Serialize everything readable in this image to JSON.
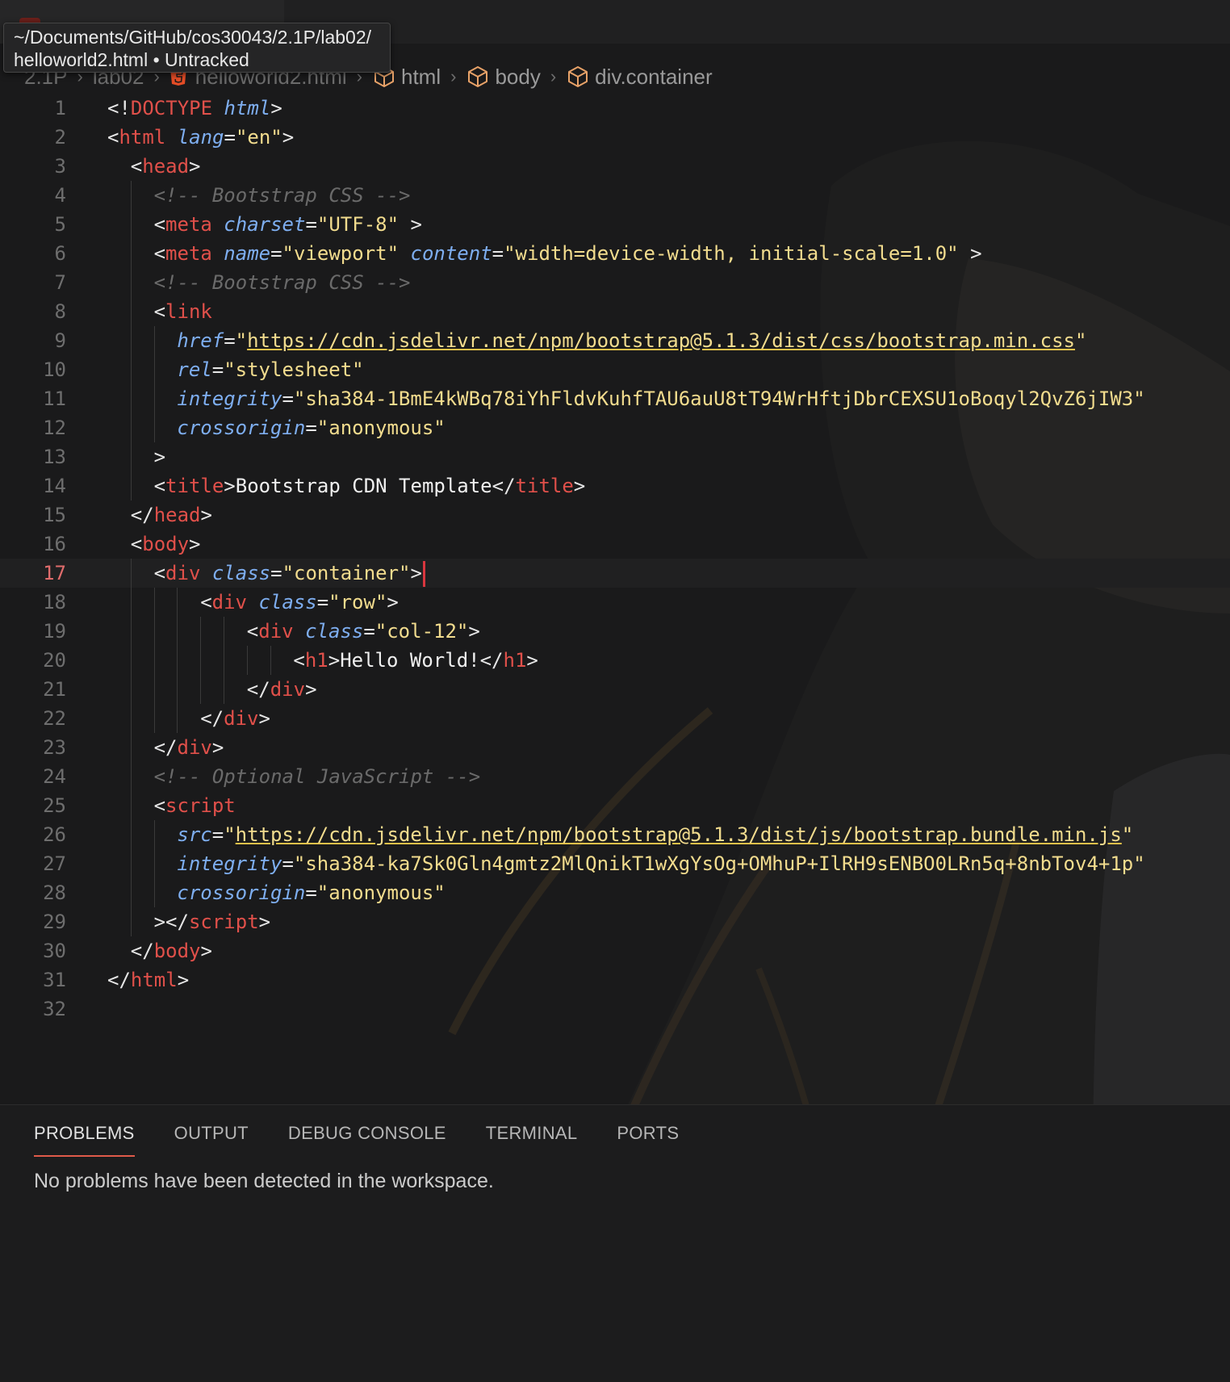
{
  "tooltip": {
    "line1": "~/Documents/GitHub/cos30043/2.1P/lab02/",
    "line2": "helloworld2.html • Untracked"
  },
  "breadcrumb": {
    "folder1": "2.1P",
    "folder2": "lab02",
    "file": "helloworld2.html",
    "sym1": "html",
    "sym2": "body",
    "sym3": "div.container"
  },
  "editor": {
    "current_line": 17,
    "lines": [
      {
        "n": "1",
        "indent": 0,
        "tokens": [
          [
            "p",
            "<!"
          ],
          [
            "t",
            "DOCTYPE"
          ],
          [
            "p",
            " "
          ],
          [
            "a",
            "html"
          ],
          [
            "p",
            ">"
          ]
        ]
      },
      {
        "n": "2",
        "indent": 0,
        "tokens": [
          [
            "p",
            "<"
          ],
          [
            "t",
            "html"
          ],
          [
            "p",
            " "
          ],
          [
            "a",
            "lang"
          ],
          [
            "p",
            "="
          ],
          [
            "v",
            "\"en\""
          ],
          [
            "p",
            ">"
          ]
        ]
      },
      {
        "n": "3",
        "indent": 1,
        "tokens": [
          [
            "p",
            "<"
          ],
          [
            "t",
            "head"
          ],
          [
            "p",
            ">"
          ]
        ]
      },
      {
        "n": "4",
        "indent": 2,
        "tokens": [
          [
            "c",
            "<!-- Bootstrap CSS -->"
          ]
        ]
      },
      {
        "n": "5",
        "indent": 2,
        "tokens": [
          [
            "p",
            "<"
          ],
          [
            "t",
            "meta"
          ],
          [
            "p",
            " "
          ],
          [
            "a",
            "charset"
          ],
          [
            "p",
            "="
          ],
          [
            "v",
            "\"UTF-8\""
          ],
          [
            "p",
            " >"
          ]
        ]
      },
      {
        "n": "6",
        "indent": 2,
        "tokens": [
          [
            "p",
            "<"
          ],
          [
            "t",
            "meta"
          ],
          [
            "p",
            " "
          ],
          [
            "a",
            "name"
          ],
          [
            "p",
            "="
          ],
          [
            "v",
            "\"viewport\""
          ],
          [
            "p",
            " "
          ],
          [
            "a",
            "content"
          ],
          [
            "p",
            "="
          ],
          [
            "v",
            "\"width=device-width, initial-scale=1.0\""
          ],
          [
            "p",
            " >"
          ]
        ]
      },
      {
        "n": "7",
        "indent": 2,
        "tokens": [
          [
            "c",
            "<!-- Bootstrap CSS -->"
          ]
        ]
      },
      {
        "n": "8",
        "indent": 2,
        "tokens": [
          [
            "p",
            "<"
          ],
          [
            "t",
            "link"
          ]
        ]
      },
      {
        "n": "9",
        "indent": 3,
        "tokens": [
          [
            "a",
            "href"
          ],
          [
            "p",
            "="
          ],
          [
            "v",
            "\""
          ],
          [
            "u",
            "https://cdn.jsdelivr.net/npm/bootstrap@5.1.3/dist/css/bootstrap.min.css"
          ],
          [
            "v",
            "\""
          ]
        ]
      },
      {
        "n": "10",
        "indent": 3,
        "tokens": [
          [
            "a",
            "rel"
          ],
          [
            "p",
            "="
          ],
          [
            "v",
            "\"stylesheet\""
          ]
        ]
      },
      {
        "n": "11",
        "indent": 3,
        "tokens": [
          [
            "a",
            "integrity"
          ],
          [
            "p",
            "="
          ],
          [
            "v",
            "\"sha384-1BmE4kWBq78iYhFldvKuhfTAU6auU8tT94WrHftjDbrCEXSU1oBoqyl2QvZ6jIW3\""
          ]
        ]
      },
      {
        "n": "12",
        "indent": 3,
        "tokens": [
          [
            "a",
            "crossorigin"
          ],
          [
            "p",
            "="
          ],
          [
            "v",
            "\"anonymous\""
          ]
        ]
      },
      {
        "n": "13",
        "indent": 2,
        "tokens": [
          [
            "p",
            ">"
          ]
        ]
      },
      {
        "n": "14",
        "indent": 2,
        "tokens": [
          [
            "p",
            "<"
          ],
          [
            "t",
            "title"
          ],
          [
            "p",
            ">"
          ],
          [
            "x",
            "Bootstrap CDN Template"
          ],
          [
            "p",
            "</"
          ],
          [
            "t",
            "title"
          ],
          [
            "p",
            ">"
          ]
        ]
      },
      {
        "n": "15",
        "indent": 1,
        "tokens": [
          [
            "p",
            "</"
          ],
          [
            "t",
            "head"
          ],
          [
            "p",
            ">"
          ]
        ]
      },
      {
        "n": "16",
        "indent": 1,
        "tokens": [
          [
            "p",
            "<"
          ],
          [
            "t",
            "body"
          ],
          [
            "p",
            ">"
          ]
        ]
      },
      {
        "n": "17",
        "indent": 2,
        "tokens": [
          [
            "p",
            "<"
          ],
          [
            "t",
            "div"
          ],
          [
            "p",
            " "
          ],
          [
            "a",
            "class"
          ],
          [
            "p",
            "="
          ],
          [
            "v",
            "\"container\""
          ],
          [
            "p",
            ">"
          ]
        ]
      },
      {
        "n": "18",
        "indent": 4,
        "tokens": [
          [
            "p",
            "<"
          ],
          [
            "t",
            "div"
          ],
          [
            "p",
            " "
          ],
          [
            "a",
            "class"
          ],
          [
            "p",
            "="
          ],
          [
            "v",
            "\"row\""
          ],
          [
            "p",
            ">"
          ]
        ]
      },
      {
        "n": "19",
        "indent": 6,
        "tokens": [
          [
            "p",
            "<"
          ],
          [
            "t",
            "div"
          ],
          [
            "p",
            " "
          ],
          [
            "a",
            "class"
          ],
          [
            "p",
            "="
          ],
          [
            "v",
            "\"col-12\""
          ],
          [
            "p",
            ">"
          ]
        ]
      },
      {
        "n": "20",
        "indent": 8,
        "tokens": [
          [
            "p",
            "<"
          ],
          [
            "t",
            "h1"
          ],
          [
            "p",
            ">"
          ],
          [
            "x",
            "Hello World!"
          ],
          [
            "p",
            "</"
          ],
          [
            "t",
            "h1"
          ],
          [
            "p",
            ">"
          ]
        ]
      },
      {
        "n": "21",
        "indent": 6,
        "tokens": [
          [
            "p",
            "</"
          ],
          [
            "t",
            "div"
          ],
          [
            "p",
            ">"
          ]
        ]
      },
      {
        "n": "22",
        "indent": 4,
        "tokens": [
          [
            "p",
            "</"
          ],
          [
            "t",
            "div"
          ],
          [
            "p",
            ">"
          ]
        ]
      },
      {
        "n": "23",
        "indent": 2,
        "tokens": [
          [
            "p",
            "</"
          ],
          [
            "t",
            "div"
          ],
          [
            "p",
            ">"
          ]
        ]
      },
      {
        "n": "24",
        "indent": 2,
        "tokens": [
          [
            "c",
            "<!-- Optional JavaScript -->"
          ]
        ]
      },
      {
        "n": "25",
        "indent": 2,
        "tokens": [
          [
            "p",
            "<"
          ],
          [
            "t",
            "script"
          ]
        ]
      },
      {
        "n": "26",
        "indent": 3,
        "tokens": [
          [
            "a",
            "src"
          ],
          [
            "p",
            "="
          ],
          [
            "v",
            "\""
          ],
          [
            "u",
            "https://cdn.jsdelivr.net/npm/bootstrap@5.1.3/dist/js/bootstrap.bundle.min.js"
          ],
          [
            "v",
            "\""
          ]
        ]
      },
      {
        "n": "27",
        "indent": 3,
        "tokens": [
          [
            "a",
            "integrity"
          ],
          [
            "p",
            "="
          ],
          [
            "v",
            "\"sha384-ka7Sk0Gln4gmtz2MlQnikT1wXgYsOg+OMhuP+IlRH9sENBO0LRn5q+8nbTov4+1p\""
          ]
        ]
      },
      {
        "n": "28",
        "indent": 3,
        "tokens": [
          [
            "a",
            "crossorigin"
          ],
          [
            "p",
            "="
          ],
          [
            "v",
            "\"anonymous\""
          ]
        ]
      },
      {
        "n": "29",
        "indent": 2,
        "tokens": [
          [
            "p",
            "></"
          ],
          [
            "t",
            "script"
          ],
          [
            "p",
            ">"
          ]
        ]
      },
      {
        "n": "30",
        "indent": 1,
        "tokens": [
          [
            "p",
            "</"
          ],
          [
            "t",
            "body"
          ],
          [
            "p",
            ">"
          ]
        ]
      },
      {
        "n": "31",
        "indent": 0,
        "tokens": [
          [
            "p",
            "</"
          ],
          [
            "t",
            "html"
          ],
          [
            "p",
            ">"
          ]
        ]
      },
      {
        "n": "32",
        "indent": 0,
        "tokens": []
      }
    ]
  },
  "panel": {
    "tabs": [
      "PROBLEMS",
      "OUTPUT",
      "DEBUG CONSOLE",
      "TERMINAL",
      "PORTS"
    ],
    "active_tab": "PROBLEMS",
    "message": "No problems have been detected in the workspace."
  }
}
